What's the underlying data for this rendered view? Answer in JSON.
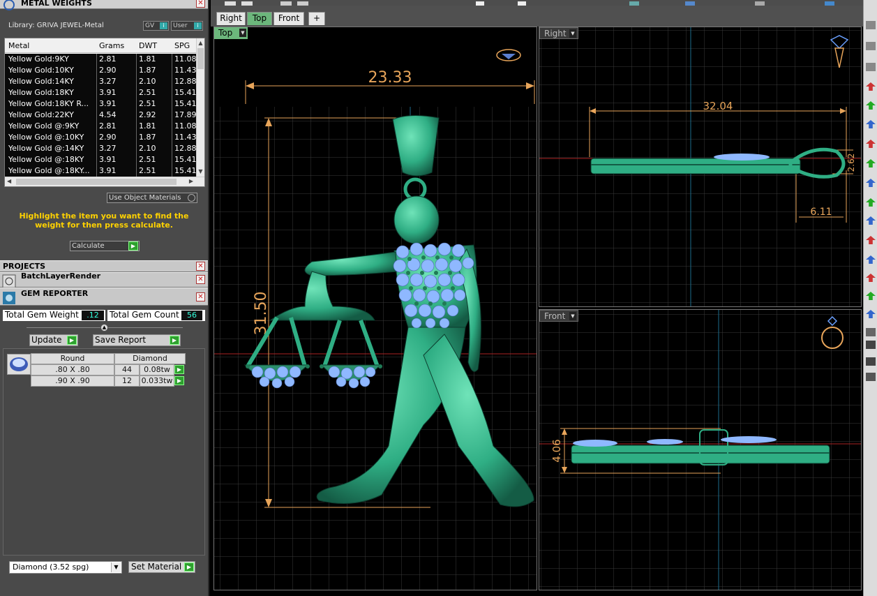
{
  "metal_weights": {
    "title": "METAL WEIGHTS",
    "library_label": "Library: GRIVA JEWEL-Metal",
    "gv_label": "GV",
    "user_label": "User",
    "columns": [
      "Metal",
      "Grams",
      "DWT",
      "SPG"
    ],
    "rows": [
      [
        "Yellow Gold:9KY",
        "2.81",
        "1.81",
        "11.08"
      ],
      [
        "Yellow Gold:10KY",
        "2.90",
        "1.87",
        "11.43"
      ],
      [
        "Yellow Gold:14KY",
        "3.27",
        "2.10",
        "12.88"
      ],
      [
        "Yellow Gold:18KY",
        "3.91",
        "2.51",
        "15.41"
      ],
      [
        "Yellow Gold:18KY R...",
        "3.91",
        "2.51",
        "15.41"
      ],
      [
        "Yellow Gold:22KY",
        "4.54",
        "2.92",
        "17.89"
      ],
      [
        "Yellow Gold @:9KY",
        "2.81",
        "1.81",
        "11.08"
      ],
      [
        "Yellow Gold @:10KY",
        "2.90",
        "1.87",
        "11.43"
      ],
      [
        "Yellow Gold @:14KY",
        "3.27",
        "2.10",
        "12.88"
      ],
      [
        "Yellow Gold @:18KY",
        "3.91",
        "2.51",
        "15.41"
      ],
      [
        "Yellow Gold @:18KY...",
        "3.91",
        "2.51",
        "15.41"
      ]
    ],
    "use_object_materials": "Use Object Materials",
    "hint": "Highlight the item you want to find the weight for then press calculate.",
    "calculate_label": "Calculate"
  },
  "projects": {
    "title": "PROJECTS"
  },
  "batch": {
    "title": "BatchLayerRender"
  },
  "gem_reporter": {
    "title": "GEM REPORTER",
    "total_weight_label": "Total Gem Weight",
    "total_weight_value": ".12",
    "total_count_label": "Total Gem Count",
    "total_count_value": "56",
    "update_label": "Update",
    "save_report_label": "Save Report",
    "header_shape": "Round",
    "header_type": "Diamond",
    "gems": [
      {
        "size": ".80 X .80",
        "count": "44",
        "weight": "0.08tw"
      },
      {
        "size": ".90 X .90",
        "count": "12",
        "weight": "0.033tw"
      }
    ],
    "material_select": "Diamond    (3.52 spg)",
    "set_material_label": "Set Material"
  },
  "tabs": [
    "Right",
    "Top",
    "Front",
    "+"
  ],
  "viewports": {
    "top": {
      "label": "Top",
      "dim_width": "23.33",
      "dim_height": "31.50"
    },
    "right": {
      "label": "Right",
      "dim_width": "32.04",
      "dim_small": "6.11",
      "dim_height": "2.62"
    },
    "front": {
      "label": "Front",
      "dim_height": "4.06"
    }
  },
  "colors": {
    "model_green": "#2fae84",
    "gem_blue": "#8fb8ff",
    "dimension": "#e8a55a",
    "grid": "#3a3a3a"
  }
}
